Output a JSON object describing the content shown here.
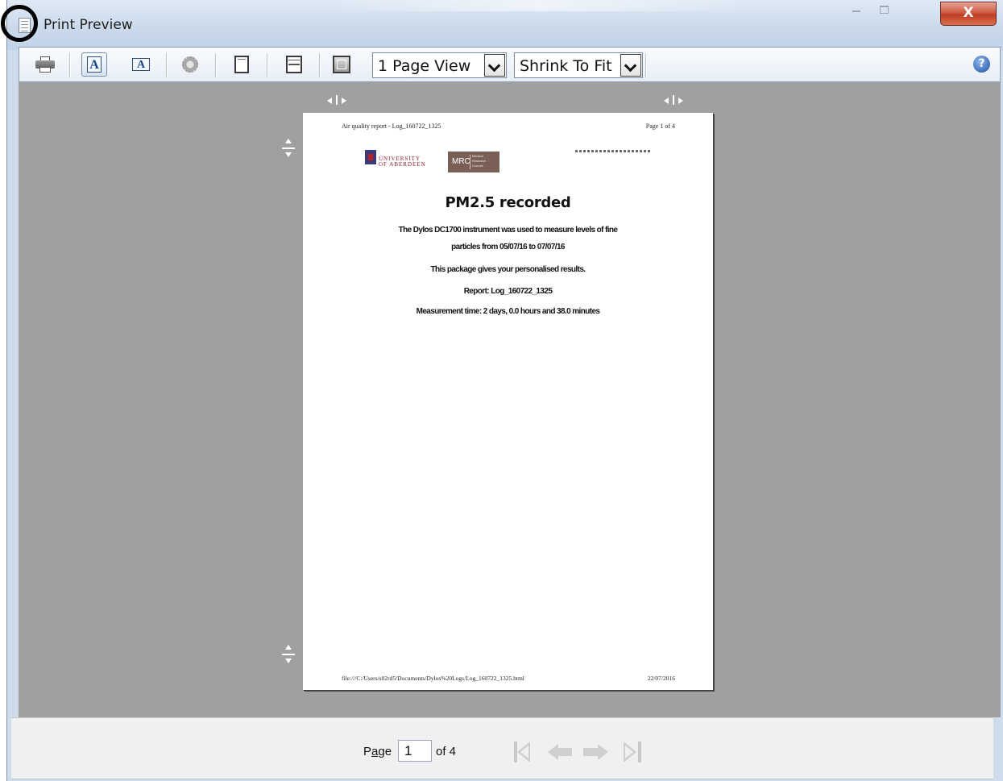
{
  "window": {
    "title": "Print Preview",
    "close_label": "X",
    "icon": "document-icon"
  },
  "toolbar": {
    "buttons": [
      {
        "name": "print",
        "icon": "printer-icon"
      },
      {
        "name": "portrait",
        "icon": "portrait-orientation-icon",
        "label": "A",
        "active": true
      },
      {
        "name": "landscape",
        "icon": "landscape-orientation-icon",
        "label": "A"
      },
      {
        "name": "page-setup",
        "icon": "gear-icon"
      },
      {
        "name": "full-width",
        "icon": "page-icon"
      },
      {
        "name": "fit-width",
        "icon": "fit-width-icon"
      },
      {
        "name": "full-page",
        "icon": "fit-page-icon"
      }
    ],
    "view_mode": "1 Page View",
    "scale_mode": "Shrink To Fit",
    "help_label": "?"
  },
  "page": {
    "header_left": "Air quality report - Log_160722_1325",
    "header_right": "Page 1 of 4",
    "logo_university_text": "UNIVERSITY OF ABERDEEN",
    "logo_mrc_text": "MRC",
    "logo_mrc_sub": "Medical Research Council",
    "title": "PM2.5 recorded",
    "lines": [
      "The Dylos DC1700 instrument was used to measure levels of fine",
      "particles from 05/07/16 to 07/07/16",
      "This package gives your personalised results.",
      "Report: Log_160722_1325",
      "Measurement time: 2 days, 0.0 hours and 38.0 minutes"
    ],
    "footer_left": "file:///C:/Users/s02rd5/Documents/Dylos%20Logs/Log_160722_1325.html",
    "footer_right": "22/07/2016"
  },
  "statusbar": {
    "page_label_prefix": "P",
    "page_label_underlined": "a",
    "page_label_suffix": "ge",
    "current_page": "1",
    "of_label": "of 4"
  },
  "colors": {
    "preview_background": "#a0a0a0",
    "close_button": "#c9452b",
    "help_icon": "#1c4fa2"
  }
}
